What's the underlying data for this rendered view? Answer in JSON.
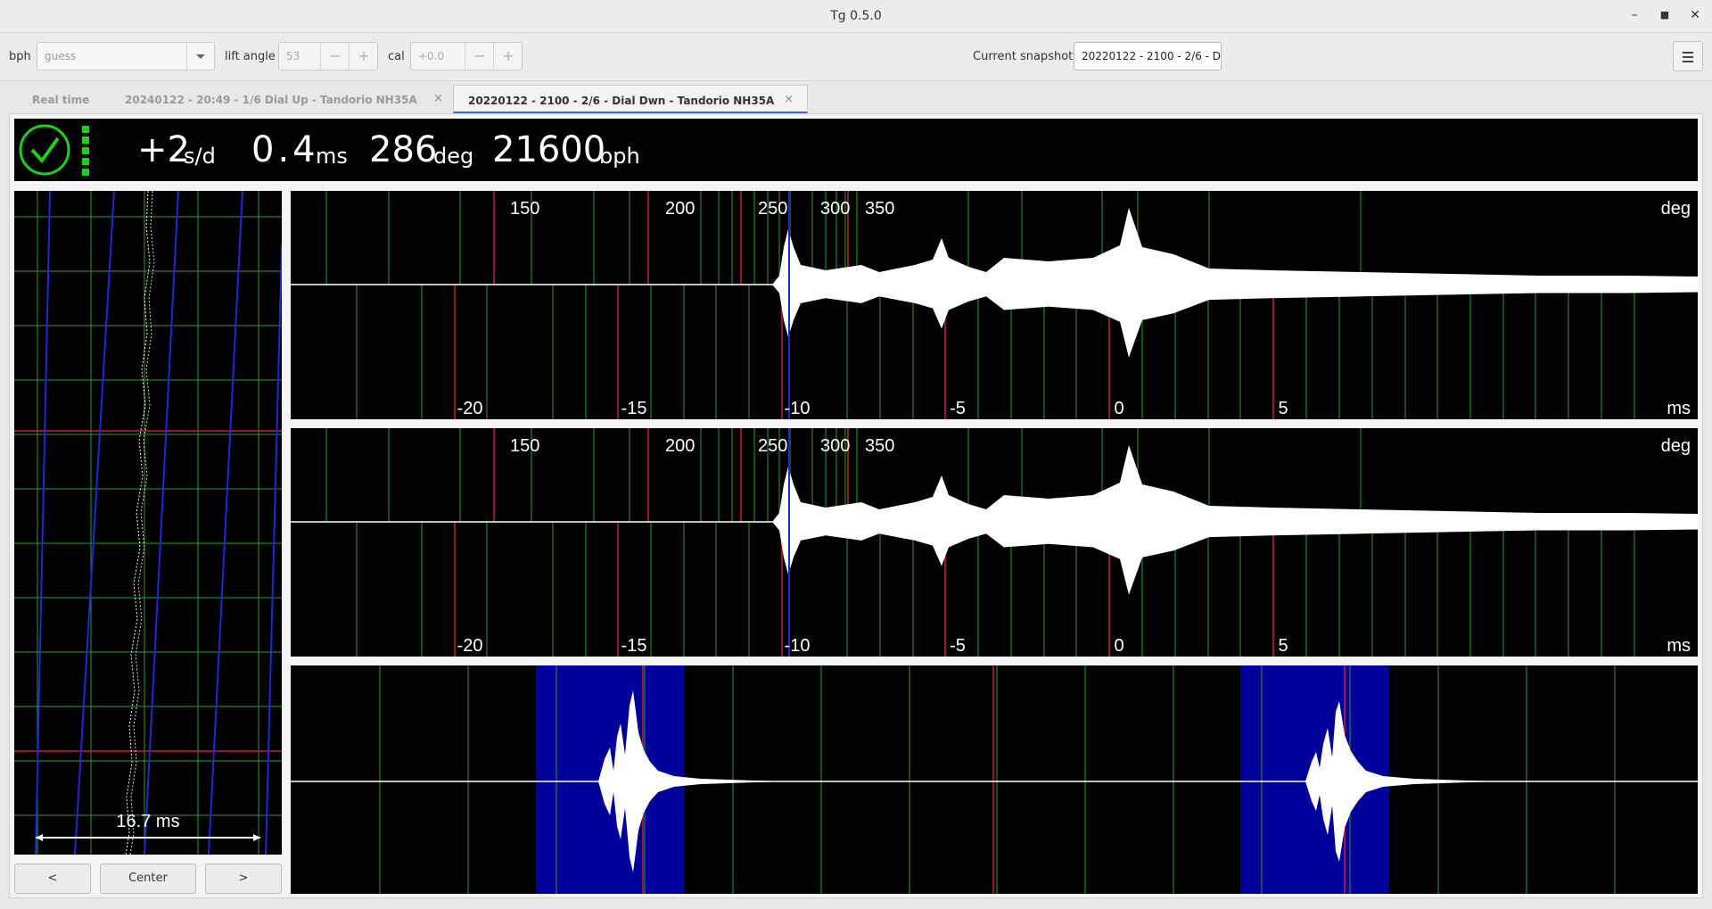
{
  "window": {
    "title": "Tg 0.5.0"
  },
  "toolbar": {
    "bph_label": "bph",
    "bph_value": "guess",
    "lift_angle_label": "lift angle",
    "lift_angle_value": "53",
    "cal_label": "cal",
    "cal_value": "+0.0",
    "minus": "−",
    "plus": "+",
    "snapshot_label": "Current snapshot:",
    "snapshot_value": "20220122 - 2100 - 2/6 - D"
  },
  "tabs": [
    {
      "label": "Real time",
      "closable": false,
      "active": false
    },
    {
      "label": "20240122 - 20:49 - 1/6 Dial Up - Tandorio NH35A",
      "closable": true,
      "active": false
    },
    {
      "label": "20220122 - 2100 - 2/6 - Dial Dwn - Tandorio NH35A",
      "closable": true,
      "active": true
    }
  ],
  "close_glyph": "×",
  "status": {
    "rate": "+2",
    "rate_unit": "s/d",
    "beat_error": "0.4",
    "beat_error_unit": "ms",
    "amplitude": "286",
    "amplitude_unit": "deg",
    "bph": "21600",
    "bph_unit": "bph",
    "signal_icon": "check-circle-icon",
    "signal_level": 1.0
  },
  "paperstrip": {
    "scale_label": "16.7 ms",
    "buttons": {
      "prev": "<",
      "center": "Center",
      "next": ">"
    }
  },
  "waveform_axes": {
    "deg_ticks": [
      "150",
      "200",
      "250",
      "300",
      "350"
    ],
    "deg_unit": "deg",
    "ms_ticks": [
      "-20",
      "-15",
      "-10",
      "-5",
      "0",
      "5"
    ],
    "ms_unit": "ms"
  },
  "colors": {
    "grid_green": "#2e9a2e",
    "grid_red": "#c42323",
    "marker_blue": "#1a2ad8",
    "highlight_blue": "#00009a",
    "indicator_green": "#1ecf1e"
  }
}
